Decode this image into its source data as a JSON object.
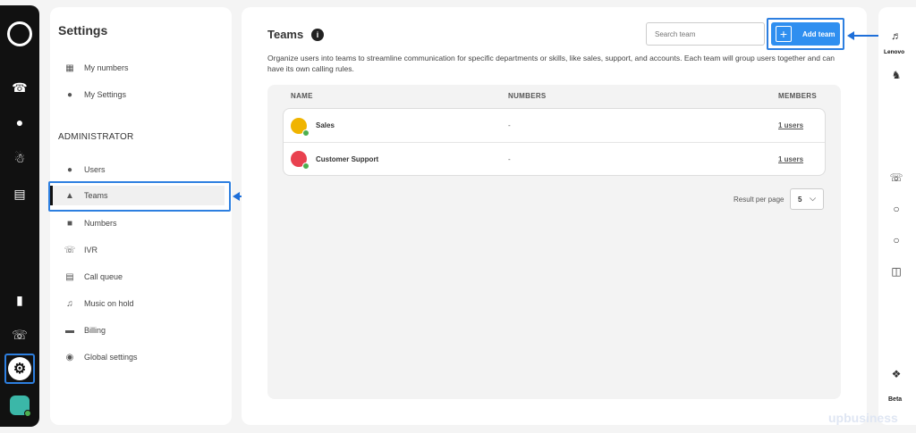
{
  "rail": {
    "icons": [
      "logo-icon",
      "phone-icon",
      "chat-icon",
      "contacts-icon",
      "clipboard-icon",
      "analytics-icon",
      "phone-add-icon",
      "gear-icon"
    ]
  },
  "settings": {
    "title": "Settings",
    "personal": [
      {
        "label": "My numbers",
        "icon": "grid-icon"
      },
      {
        "label": "My Settings",
        "icon": "user-settings-icon"
      }
    ],
    "admin_heading": "ADMINISTRATOR",
    "admin": [
      {
        "label": "Users",
        "icon": "users-icon"
      },
      {
        "label": "Teams",
        "icon": "teams-icon"
      },
      {
        "label": "Numbers",
        "icon": "numbers-icon"
      },
      {
        "label": "IVR",
        "icon": "ivr-icon"
      },
      {
        "label": "Call queue",
        "icon": "call-queue-icon"
      },
      {
        "label": "Music on hold",
        "icon": "music-hold-icon"
      },
      {
        "label": "Billing",
        "icon": "billing-icon"
      },
      {
        "label": "Global settings",
        "icon": "globe-settings-icon"
      }
    ]
  },
  "main": {
    "title": "Teams",
    "info": "i",
    "description": "Organize users into teams to streamline communication for specific departments or skills, like sales, support, and accounts. Each team will group users together and can have its own calling rules.",
    "search_placeholder": "Search team",
    "add_label": "Add team",
    "columns": {
      "name": "NAME",
      "numbers": "NUMBERS",
      "members": "MEMBERS"
    },
    "rows": [
      {
        "name": "Sales",
        "numbers": "-",
        "members": "1 users",
        "avatar_color": "#f0b400"
      },
      {
        "name": "Customer Support",
        "numbers": "-",
        "members": "1 users",
        "avatar_color": "#e9414f"
      }
    ],
    "rpp_label": "Result per page",
    "rpp_value": "5",
    "rpp_chevron": "⌵"
  },
  "right_rail": {
    "device": "Lenovo",
    "beta": "Beta"
  },
  "watermark": "upbusiness",
  "colors": {
    "accent": "#2f8ff0",
    "highlight": "#2d7fe0",
    "rail": "#111111"
  }
}
